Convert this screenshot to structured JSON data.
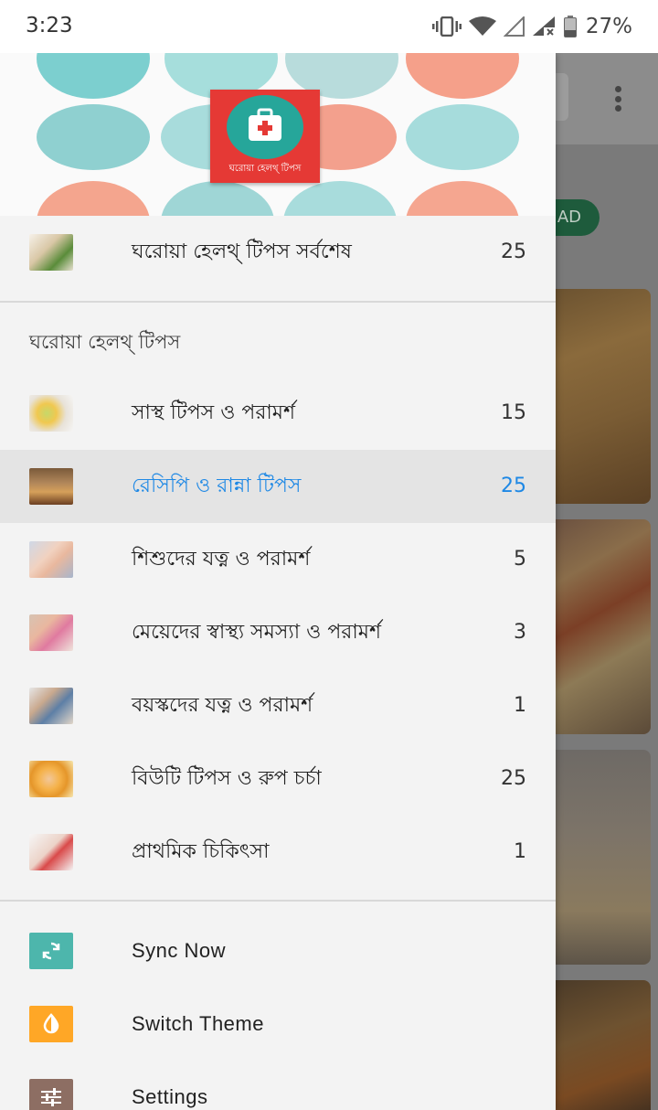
{
  "status_bar": {
    "time": "3:23",
    "battery_percent": "27%",
    "icons": [
      "vibrate-icon",
      "wifi-icon",
      "signal-empty-icon",
      "signal-icon",
      "battery-icon"
    ]
  },
  "background_app": {
    "pill_text": "AD",
    "menu_icon": "more-vert-icon"
  },
  "drawer": {
    "header": {
      "logo_caption": "ঘরোয়া হেলথ্ টিপস"
    },
    "latest": {
      "label": "ঘরোয়া হেলথ্ টিপস সর্বশেষ",
      "count": "25"
    },
    "section_title": "ঘরোয়া হেলথ্ টিপস",
    "categories": [
      {
        "label": "সাস্থ টিপস ও পরামর্শ",
        "count": "15",
        "active": false
      },
      {
        "label": "রেসিপি ও রান্না টিপস",
        "count": "25",
        "active": true
      },
      {
        "label": "শিশুদের যত্ন ও পরামর্শ",
        "count": "5",
        "active": false
      },
      {
        "label": "মেয়েদের স্বাস্থ্য সমস্যা ও পরামর্শ",
        "count": "3",
        "active": false
      },
      {
        "label": "বয়স্কদের যত্ন ও পরামর্শ",
        "count": "1",
        "active": false
      },
      {
        "label": "বিউটি টিপস ও রুপ চর্চা",
        "count": "25",
        "active": false
      },
      {
        "label": "প্রাথমিক চিকিৎসা",
        "count": "1",
        "active": false
      }
    ],
    "actions": [
      {
        "label": "Sync Now",
        "icon": "sync-icon",
        "color": "#4db6ac"
      },
      {
        "label": "Switch Theme",
        "icon": "theme-icon",
        "color": "#ffa726"
      },
      {
        "label": "Settings",
        "icon": "settings-sliders-icon",
        "color": "#8d6e63"
      }
    ],
    "accent_color": "#1e88e5"
  }
}
